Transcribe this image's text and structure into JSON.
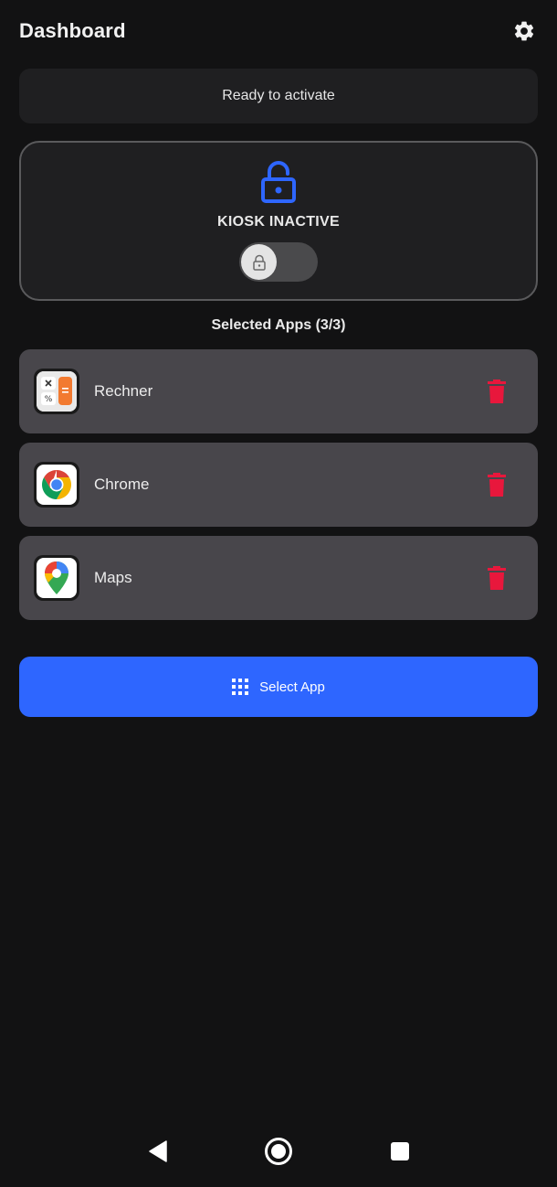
{
  "header": {
    "title": "Dashboard",
    "settings_icon": "gear-icon"
  },
  "status": {
    "text": "Ready to activate"
  },
  "kiosk": {
    "label": "KIOSK INACTIVE",
    "lock_icon": "lock-open-icon",
    "toggle_on": false,
    "accent": "#2e66ff"
  },
  "apps_section": {
    "title": "Selected Apps (3/3)"
  },
  "apps": [
    {
      "name": "Rechner",
      "icon": "calculator-icon"
    },
    {
      "name": "Chrome",
      "icon": "chrome-icon"
    },
    {
      "name": "Maps",
      "icon": "maps-icon"
    }
  ],
  "select_button": {
    "label": "Select App",
    "icon": "grid-icon",
    "color": "#2e66ff"
  },
  "delete_color": "#e8173c",
  "navbar": {
    "back_icon": "back-icon",
    "home_icon": "home-icon",
    "recents_icon": "recents-icon"
  }
}
